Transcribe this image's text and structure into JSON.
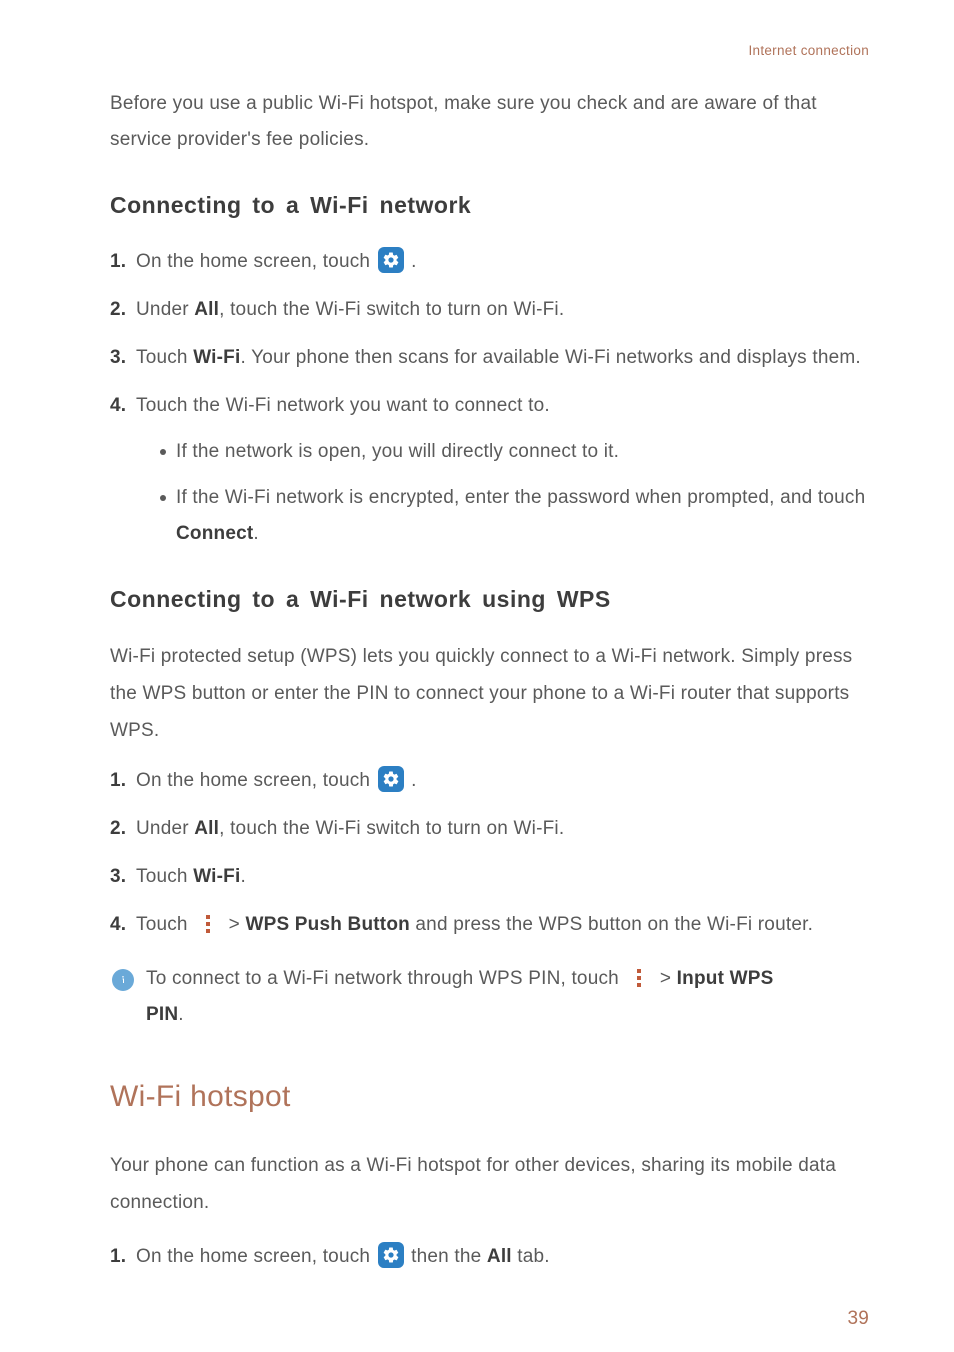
{
  "header": {
    "breadcrumb": "Internet connection"
  },
  "intro": "Before you use a public Wi-Fi hotspot, make sure you check and are aware of that service provider's fee policies.",
  "section1": {
    "heading": "Connecting to a Wi-Fi network",
    "steps": {
      "s1": {
        "num": "1.",
        "pre": "On the home screen, touch ",
        "post": "."
      },
      "s2": {
        "num": "2.",
        "a": "Under ",
        "all": "All",
        "b": ", touch the Wi-Fi switch to turn on Wi-Fi."
      },
      "s3": {
        "num": "3.",
        "a": "Touch ",
        "wifi": "Wi-Fi",
        "b": ". Your phone then scans for available Wi-Fi networks and displays them."
      },
      "s4": {
        "num": "4.",
        "text": "Touch the Wi-Fi network you want to connect to.",
        "b1": "If the network is open, you will directly connect to it.",
        "b2a": "If the Wi-Fi network is encrypted, enter the password when prompted, and touch ",
        "b2connect": "Connect",
        "b2b": "."
      }
    }
  },
  "section2": {
    "heading": "Connecting to a Wi-Fi network using WPS",
    "intro": "Wi-Fi protected setup (WPS) lets you quickly connect to a Wi-Fi network. Simply press the WPS button or enter the PIN to connect your phone to a Wi-Fi router that supports WPS.",
    "steps": {
      "s1": {
        "num": "1.",
        "pre": "On the home screen, touch ",
        "post": "."
      },
      "s2": {
        "num": "2.",
        "a": "Under ",
        "all": "All",
        "b": ", touch the Wi-Fi switch to turn on Wi-Fi."
      },
      "s3": {
        "num": "3.",
        "a": "Touch ",
        "wifi": "Wi-Fi",
        "b": "."
      },
      "s4": {
        "num": "4.",
        "a": "Touch ",
        "gt": " > ",
        "btn": "WPS Push Button",
        "b": " and press the WPS button on the Wi-Fi router."
      }
    },
    "note": {
      "a": "To connect to a Wi-Fi network through WPS PIN, touch ",
      "gt": " > ",
      "input": "Input WPS ",
      "pin": "PIN",
      "b": "."
    }
  },
  "section3": {
    "heading": "Wi-Fi hotspot",
    "intro": "Your phone can function as a Wi-Fi hotspot for other devices, sharing its mobile data connection.",
    "step1": {
      "num": "1.",
      "a": "On the home screen, touch ",
      "b": " then the ",
      "all": "All",
      "c": " tab."
    }
  },
  "page": "39"
}
